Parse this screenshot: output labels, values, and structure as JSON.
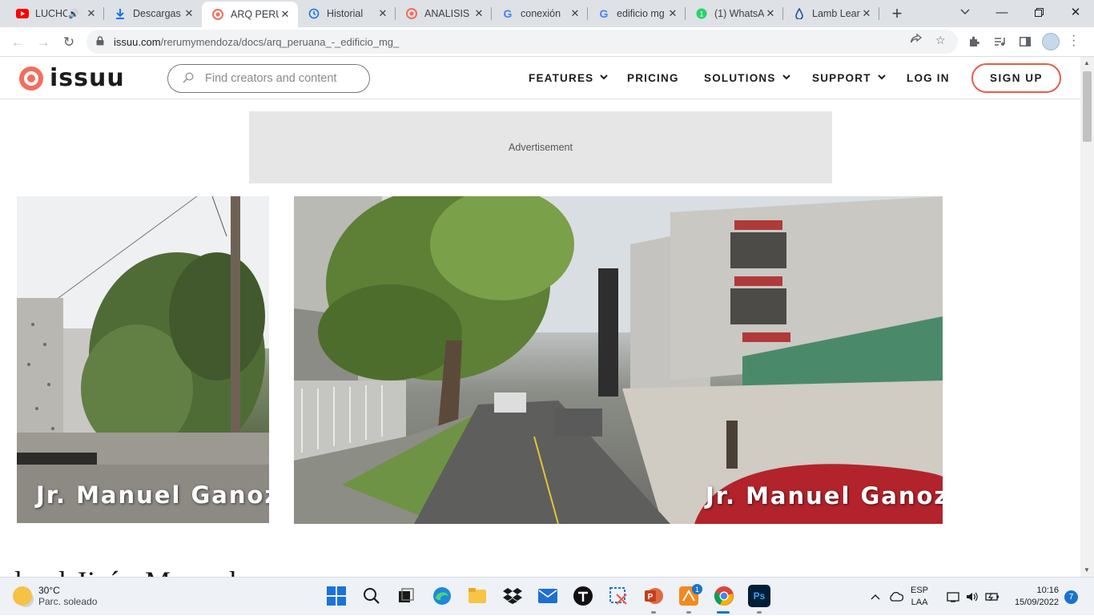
{
  "browser": {
    "tabs": [
      {
        "title": "LUCHO",
        "icon": "youtube-icon",
        "active": false
      },
      {
        "title": "Descargas",
        "icon": "download-icon",
        "active": false
      },
      {
        "title": "ARQ PERU",
        "icon": "issuu-icon",
        "active": true
      },
      {
        "title": "Historial",
        "icon": "history-icon",
        "active": false
      },
      {
        "title": "ANALISIS",
        "icon": "issuu-icon",
        "active": false
      },
      {
        "title": "conexión",
        "icon": "google-icon",
        "active": false
      },
      {
        "title": "edificio mg",
        "icon": "google-icon",
        "active": false
      },
      {
        "title": "(1) WhatsA",
        "icon": "whatsapp-icon",
        "active": false
      },
      {
        "title": "Lamb Lear",
        "icon": "lamb-icon",
        "active": false
      }
    ],
    "url_host": "issuu.com",
    "url_path": "/rerumymendoza/docs/arq_peruana_-_edificio_mg_"
  },
  "issuu": {
    "logo_text": "issuu",
    "search_placeholder": "Find creators and content",
    "nav": {
      "features": "FEATURES",
      "pricing": "PRICING",
      "solutions": "SOLUTIONS",
      "support": "SUPPORT",
      "login": "LOG IN",
      "signup": "SIGN UP"
    },
    "accent_color": "#f36d5d"
  },
  "page": {
    "ad_label": "Advertisement",
    "photo_left_caption": "Jr. Manuel Ganoza",
    "photo_right_caption": "Jr. Manuel Ganoza",
    "body_text": "la el Jirón Manuel"
  },
  "taskbar": {
    "weather_temp": "30°C",
    "weather_desc": "Parc. soleado",
    "lang_1": "ESP",
    "lang_2": "LAA",
    "time": "10:16",
    "date": "15/09/2022",
    "notification_count": "7",
    "store_badge": "1"
  }
}
